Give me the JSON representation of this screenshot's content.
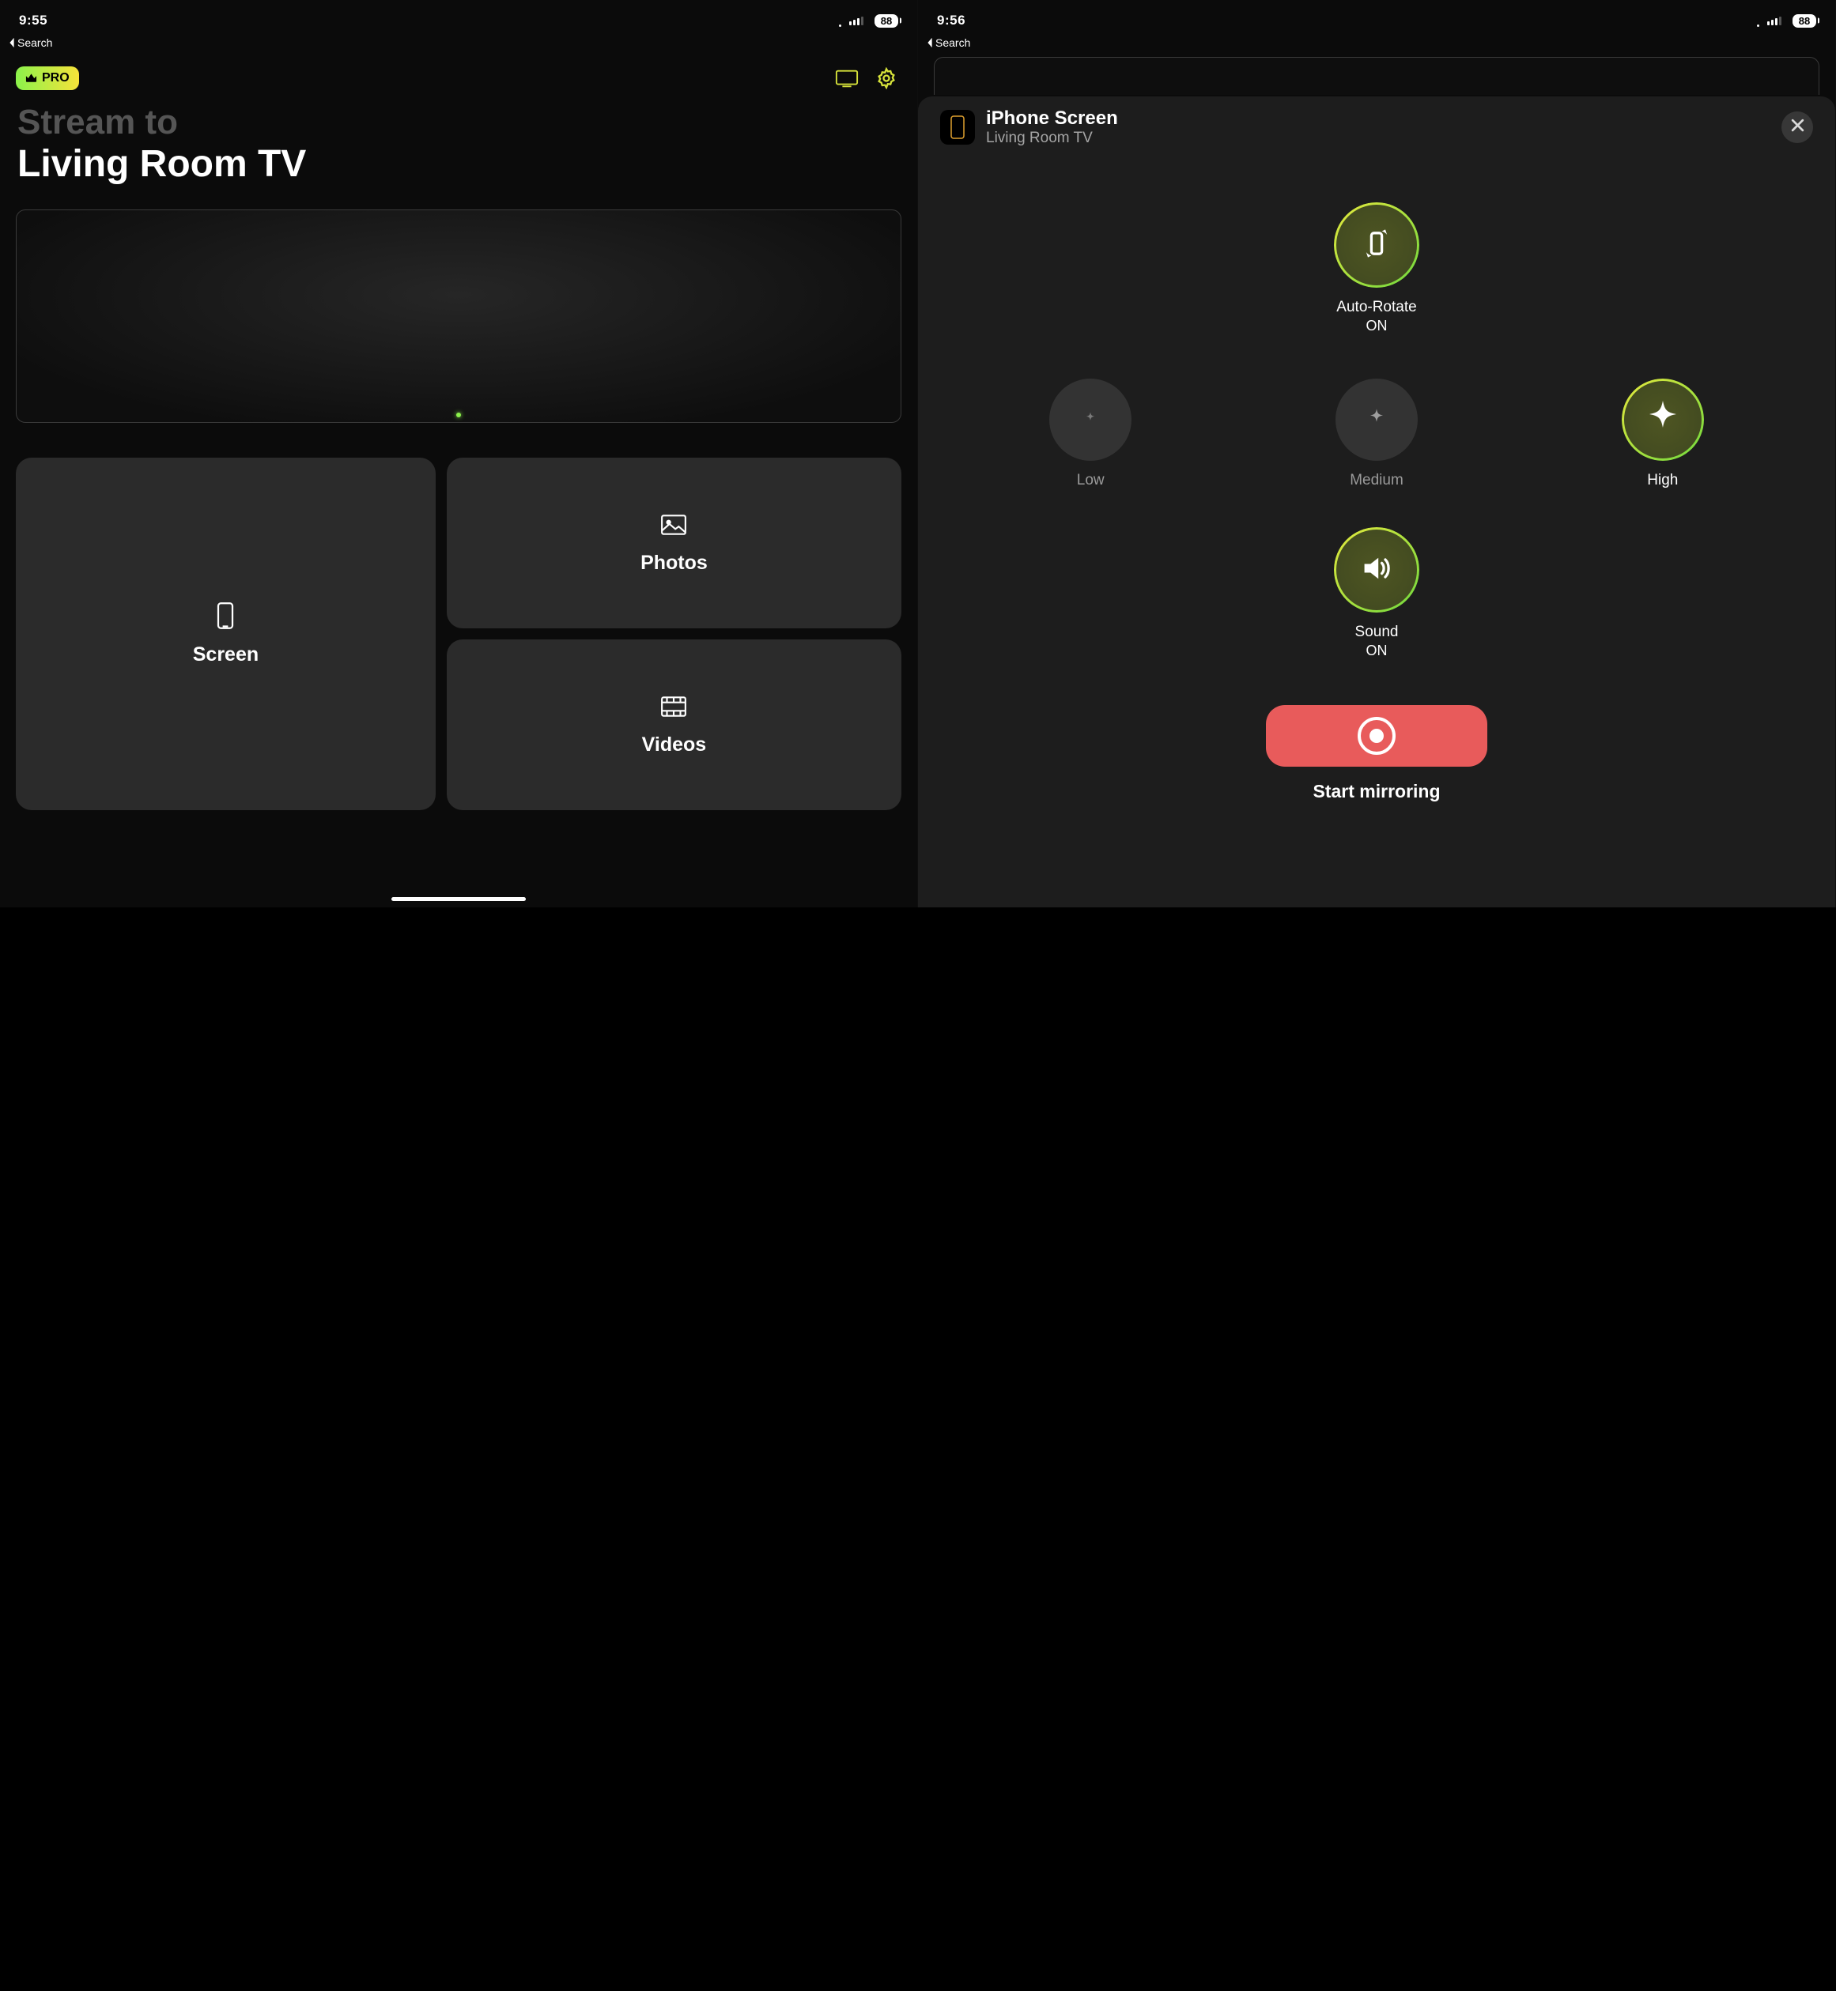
{
  "left": {
    "status": {
      "time": "9:55",
      "battery": "88",
      "back": "Search"
    },
    "pro": "PRO",
    "title_sub": "Stream to",
    "title_main": "Living Room TV",
    "tiles": {
      "screen": "Screen",
      "photos": "Photos",
      "videos": "Videos"
    }
  },
  "right": {
    "status": {
      "time": "9:56",
      "battery": "88",
      "back": "Search"
    },
    "sheet": {
      "title": "iPhone Screen",
      "subtitle": "Living Room TV",
      "rotate": {
        "label": "Auto-Rotate",
        "state": "ON"
      },
      "quality": {
        "low": "Low",
        "medium": "Medium",
        "high": "High"
      },
      "sound": {
        "label": "Sound",
        "state": "ON"
      },
      "start": "Start mirroring"
    }
  }
}
